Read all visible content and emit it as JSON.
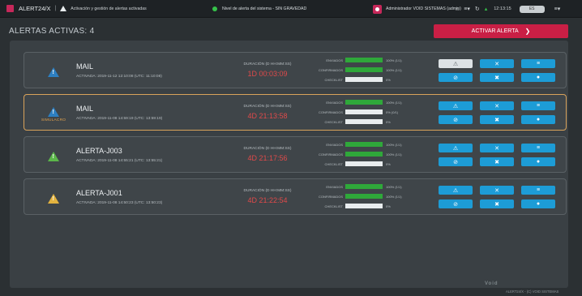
{
  "topbar": {
    "app_title": "ALERT24/X",
    "separator": "|",
    "subtitle": "Activación y gestión de alertas activadas",
    "status_text": "Nivel de alerta del sistema - SIN GRAVEDAD",
    "admin_text": "Administrador VOID SISTEMAS (admin)",
    "time": "12:13:15",
    "user_pill": "ES"
  },
  "header": {
    "title": "ALERTAS ACTIVAS: 4",
    "activate_label": "ACTIVAR ALERTA",
    "activate_chevron": "❯"
  },
  "labels": {
    "duration": "DURACIÓN (D HH:MM:SS)",
    "sent": "ENVIADOS",
    "confirmed": "CONFIRMADOS",
    "checklist": "CHECKLIST",
    "simulacro": "SIMULACRO"
  },
  "alerts": [
    {
      "name": "MAIL",
      "activated": "ACTIVADA: 2019-11-12 12:10:08 (UTC: 11:10:08)",
      "duration": "1D 00:03:09",
      "icon_color": "#2d7fc1",
      "sent_text": "100% (1/1)",
      "sent_fraction": 1,
      "confirmed_text": "100% (1/1)",
      "confirmed_fraction": 1,
      "checklist_text": "0%",
      "checklist_fraction": 0
    },
    {
      "name": "MAIL",
      "activated": "ACTIVADA: 2019-11-08 14:59:19 (UTC: 13:59:19)",
      "duration": "4D 21:13:58",
      "icon_color": "#2d7fc1",
      "simulacro": true,
      "sent_text": "100% (1/1)",
      "sent_fraction": 1,
      "confirmed_text": "0% (0/1)",
      "confirmed_fraction": 0,
      "checklist_text": "0%",
      "checklist_fraction": 0
    },
    {
      "name": "ALERTA-J003",
      "activated": "ACTIVADA: 2019-11-08 14:55:21 (UTC: 13:55:21)",
      "duration": "4D 21:17:56",
      "icon_color": "#5bb64a",
      "sent_text": "100% (1/1)",
      "sent_fraction": 1,
      "confirmed_text": "100% (1/1)",
      "confirmed_fraction": 1,
      "checklist_text": "0%",
      "checklist_fraction": 0
    },
    {
      "name": "ALERTA-J001",
      "activated": "ACTIVADA: 2019-11-08 14:50:23 (UTC: 13:50:23)",
      "duration": "4D 21:22:54",
      "icon_color": "#e3b33f",
      "sent_text": "100% (1/1)",
      "sent_fraction": 1,
      "confirmed_text": "100% (1/1)",
      "confirmed_fraction": 1,
      "checklist_text": "0%",
      "checklist_fraction": 0
    }
  ],
  "buttons": {
    "escalate_icon": "⚠",
    "close_icon": "✕",
    "list_icon": "≡",
    "cancel_icon": "⊘",
    "stop_icon": "✖",
    "chat_icon": "●"
  },
  "footer": {
    "logo": "Void",
    "copyright": "ALERT24/X - (C) VOID SISTEMAS"
  },
  "colors": {
    "accent_red": "#c91f45",
    "button_blue": "#1d9cd6",
    "progress_green": "#2fa83a",
    "duration_red": "#e04a4a",
    "simulacro_border": "#d9a35b"
  }
}
